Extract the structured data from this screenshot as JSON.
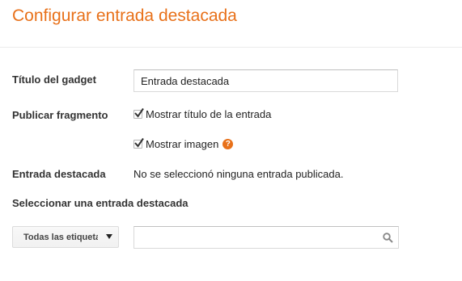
{
  "header": {
    "title": "Configurar entrada destacada"
  },
  "form": {
    "gadget_title_label": "Título del gadget",
    "gadget_title_value": "Entrada destacada",
    "publish_snippet_label": "Publicar fragmento",
    "show_title_option": {
      "label": "Mostrar título de la entrada",
      "checked": true
    },
    "show_image_option": {
      "label": "Mostrar imagen",
      "checked": true,
      "help_icon": "question-circle-icon",
      "help_glyph": "?"
    },
    "featured_post_label": "Entrada destacada",
    "featured_post_status": "No se seleccionó ninguna entrada publicada.",
    "select_featured_heading": "Seleccionar una entrada destacada",
    "labels_dropdown_value": "Todas las etiquetas",
    "search_input_value": "",
    "search_icon": "magnifier-icon"
  },
  "colors": {
    "accent": "#e8711a",
    "divider": "#ebebeb",
    "text": "#222222"
  }
}
